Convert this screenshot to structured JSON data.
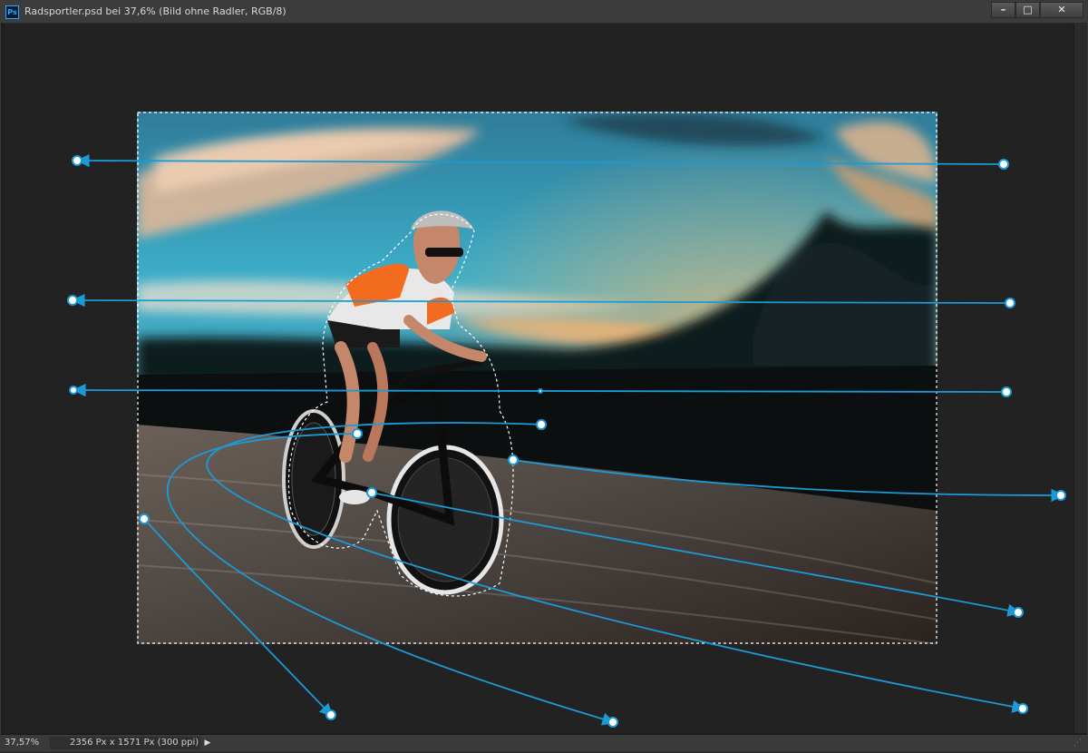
{
  "app": {
    "icon_label": "Ps"
  },
  "window": {
    "title": "Radsportler.psd bei 37,6% (Bild ohne Radler, RGB/8)",
    "minimize_icon": "minimize-icon",
    "maximize_icon": "maximize-icon",
    "close_icon": "close-icon",
    "minimize_glyph": "–",
    "maximize_glyph": "□",
    "close_glyph": "✕"
  },
  "status": {
    "zoom": "37,57%",
    "doc_size": "2356 Px x 1571 Px (300 ppi)",
    "menu_arrow": "▶"
  },
  "colors": {
    "pin": "#1c9ad6",
    "pin_fill": "#ffffff",
    "selection": "#e8e8e8",
    "title_bar": "#3c3c3c",
    "canvas": "#222222"
  }
}
